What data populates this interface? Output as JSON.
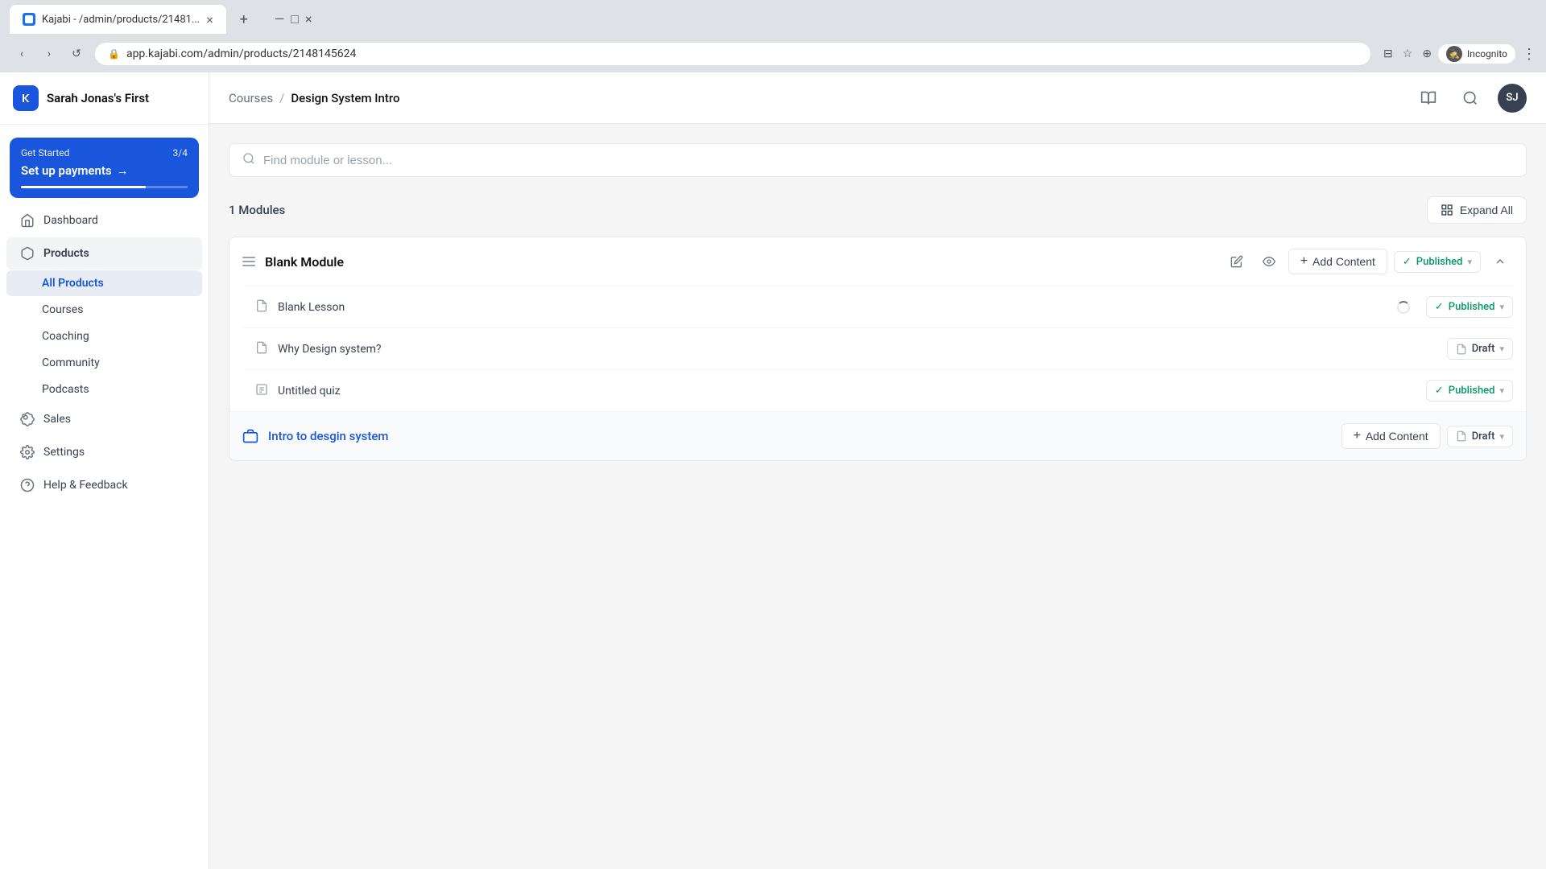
{
  "browser": {
    "tab_title": "Kajabi - /admin/products/21481...",
    "tab_close": "×",
    "new_tab": "+",
    "url": "app.kajabi.com/admin/products/2148145624",
    "nav_back": "‹",
    "nav_forward": "›",
    "nav_refresh": "↺",
    "incognito_label": "Incognito",
    "more_btn": "⋮",
    "window_minimize": "—",
    "window_maximize": "□",
    "window_close": "×"
  },
  "sidebar": {
    "brand": "Sarah Jonas's First",
    "get_started": {
      "label": "Get Started",
      "progress": "3/4",
      "title": "Set up payments",
      "arrow": "→"
    },
    "nav_items": [
      {
        "id": "dashboard",
        "label": "Dashboard",
        "icon": "home"
      },
      {
        "id": "products",
        "label": "Products",
        "icon": "box",
        "active": true
      },
      {
        "id": "sales",
        "label": "Sales",
        "icon": "tag"
      },
      {
        "id": "settings",
        "label": "Settings",
        "icon": "gear"
      },
      {
        "id": "help",
        "label": "Help & Feedback",
        "icon": "help"
      }
    ],
    "sub_items": [
      {
        "id": "all-products",
        "label": "All Products",
        "active": true
      },
      {
        "id": "courses",
        "label": "Courses"
      },
      {
        "id": "coaching",
        "label": "Coaching"
      },
      {
        "id": "community",
        "label": "Community"
      },
      {
        "id": "podcasts",
        "label": "Podcasts"
      }
    ]
  },
  "header": {
    "breadcrumb_parent": "Courses",
    "breadcrumb_sep": "/",
    "breadcrumb_current": "Design System Intro",
    "user_initials": "SJ"
  },
  "search": {
    "placeholder": "Find module or lesson..."
  },
  "modules_section": {
    "count": "1",
    "count_label": "Modules",
    "expand_all": "Expand All"
  },
  "blank_module": {
    "title": "Blank Module",
    "add_content": "+ Add Content",
    "status": "Published",
    "lessons": [
      {
        "title": "Blank Lesson",
        "status": "Published",
        "status_type": "published",
        "has_loading": true
      },
      {
        "title": "Why Design system?",
        "status": "Draft",
        "status_type": "draft",
        "has_loading": false
      },
      {
        "title": "Untitled quiz",
        "status": "Published",
        "status_type": "published",
        "has_loading": false
      }
    ]
  },
  "sub_module": {
    "title": "Intro to desgin system",
    "add_content": "+ Add Content",
    "status": "Draft",
    "status_type": "draft"
  }
}
